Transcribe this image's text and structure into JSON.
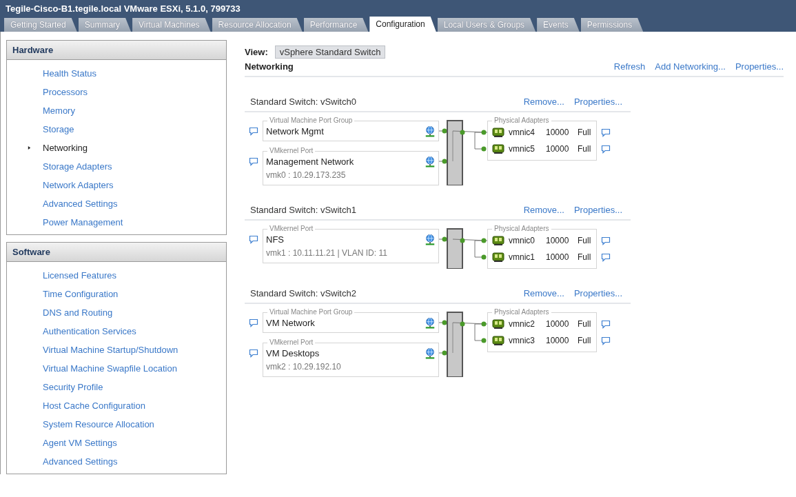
{
  "window": {
    "title": "Tegile-Cisco-B1.tegile.local VMware ESXi, 5.1.0, 799733"
  },
  "tabs": [
    {
      "label": "Getting Started",
      "selected": false
    },
    {
      "label": "Summary",
      "selected": false
    },
    {
      "label": "Virtual Machines",
      "selected": false
    },
    {
      "label": "Resource Allocation",
      "selected": false
    },
    {
      "label": "Performance",
      "selected": false
    },
    {
      "label": "Configuration",
      "selected": true
    },
    {
      "label": "Local Users & Groups",
      "selected": false
    },
    {
      "label": "Events",
      "selected": false
    },
    {
      "label": "Permissions",
      "selected": false
    }
  ],
  "sidebar": {
    "sections": [
      {
        "title": "Hardware",
        "items": [
          {
            "label": "Health Status",
            "selected": false
          },
          {
            "label": "Processors",
            "selected": false
          },
          {
            "label": "Memory",
            "selected": false
          },
          {
            "label": "Storage",
            "selected": false
          },
          {
            "label": "Networking",
            "selected": true
          },
          {
            "label": "Storage Adapters",
            "selected": false
          },
          {
            "label": "Network Adapters",
            "selected": false
          },
          {
            "label": "Advanced Settings",
            "selected": false
          },
          {
            "label": "Power Management",
            "selected": false
          }
        ]
      },
      {
        "title": "Software",
        "items": [
          {
            "label": "Licensed Features",
            "selected": false
          },
          {
            "label": "Time Configuration",
            "selected": false
          },
          {
            "label": "DNS and Routing",
            "selected": false
          },
          {
            "label": "Authentication Services",
            "selected": false
          },
          {
            "label": "Virtual Machine Startup/Shutdown",
            "selected": false
          },
          {
            "label": "Virtual Machine Swapfile Location",
            "selected": false
          },
          {
            "label": "Security Profile",
            "selected": false
          },
          {
            "label": "Host Cache Configuration",
            "selected": false
          },
          {
            "label": "System Resource Allocation",
            "selected": false
          },
          {
            "label": "Agent VM Settings",
            "selected": false
          },
          {
            "label": "Advanced Settings",
            "selected": false
          }
        ]
      }
    ]
  },
  "view": {
    "label": "View:",
    "value": "vSphere Standard Switch"
  },
  "section": {
    "title": "Networking",
    "actions": [
      "Refresh",
      "Add Networking...",
      "Properties..."
    ]
  },
  "switches": [
    {
      "title": "Standard Switch: vSwitch0",
      "actions": [
        "Remove...",
        "Properties..."
      ],
      "ports": [
        {
          "group_label": "Virtual Machine Port Group",
          "name": "Network Mgmt"
        },
        {
          "group_label": "VMkernel Port",
          "name": "Management Network",
          "address": "vmk0 : 10.29.173.235"
        }
      ],
      "adapters_label": "Physical Adapters",
      "adapters": [
        {
          "name": "vmnic4",
          "speed": "10000",
          "duplex": "Full"
        },
        {
          "name": "vmnic5",
          "speed": "10000",
          "duplex": "Full"
        }
      ]
    },
    {
      "title": "Standard Switch: vSwitch1",
      "actions": [
        "Remove...",
        "Properties..."
      ],
      "ports": [
        {
          "group_label": "VMkernel Port",
          "name": "NFS",
          "address": "vmk1 : 10.11.11.21 | VLAN ID: 11"
        }
      ],
      "adapters_label": "Physical Adapters",
      "adapters": [
        {
          "name": "vmnic0",
          "speed": "10000",
          "duplex": "Full"
        },
        {
          "name": "vmnic1",
          "speed": "10000",
          "duplex": "Full"
        }
      ]
    },
    {
      "title": "Standard Switch: vSwitch2",
      "actions": [
        "Remove...",
        "Properties..."
      ],
      "ports": [
        {
          "group_label": "Virtual Machine Port Group",
          "name": "VM Network"
        },
        {
          "group_label": "VMkernel Port",
          "name": "VM Desktops",
          "address": "vmk2 : 10.29.192.10"
        }
      ],
      "adapters_label": "Physical Adapters",
      "adapters": [
        {
          "name": "vmnic2",
          "speed": "10000",
          "duplex": "Full"
        },
        {
          "name": "vmnic3",
          "speed": "10000",
          "duplex": "Full"
        }
      ]
    }
  ]
}
